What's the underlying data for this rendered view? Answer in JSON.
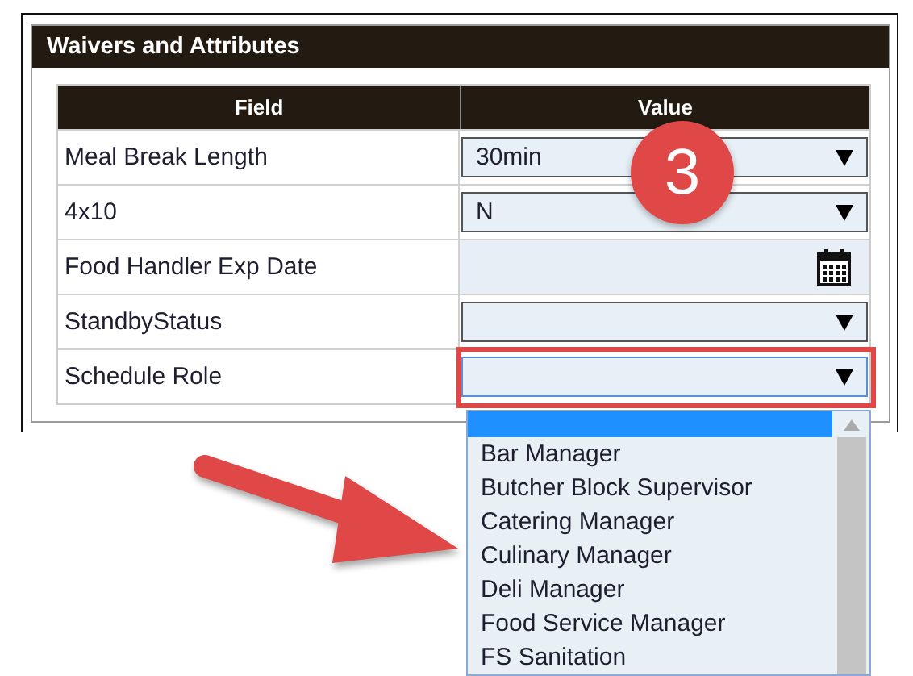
{
  "panel": {
    "title": "Waivers and Attributes"
  },
  "table": {
    "columns": [
      "Field",
      "Value"
    ],
    "rows": [
      {
        "field": "Meal Break Length",
        "kind": "select",
        "value": "30min",
        "open": false
      },
      {
        "field": "4x10",
        "kind": "select",
        "value": "N",
        "open": false
      },
      {
        "field": "Food Handler Exp Date",
        "kind": "date"
      },
      {
        "field": "StandbyStatus",
        "kind": "select",
        "open": false
      },
      {
        "field": "Schedule Role",
        "kind": "select",
        "open": true,
        "highlighted": true,
        "options": [
          {
            "selected": true
          },
          {
            "label": "Bar Manager",
            "selected": false
          },
          {
            "label": "Butcher Block Supervisor",
            "selected": false
          },
          {
            "label": "Catering Manager",
            "selected": false
          },
          {
            "label": "Culinary Manager",
            "selected": false
          },
          {
            "label": "Deli Manager",
            "selected": false
          },
          {
            "label": "Food Service Manager",
            "selected": false
          },
          {
            "label": "FS Sanitation",
            "selected": false
          }
        ]
      }
    ]
  },
  "step_badge": "3"
}
